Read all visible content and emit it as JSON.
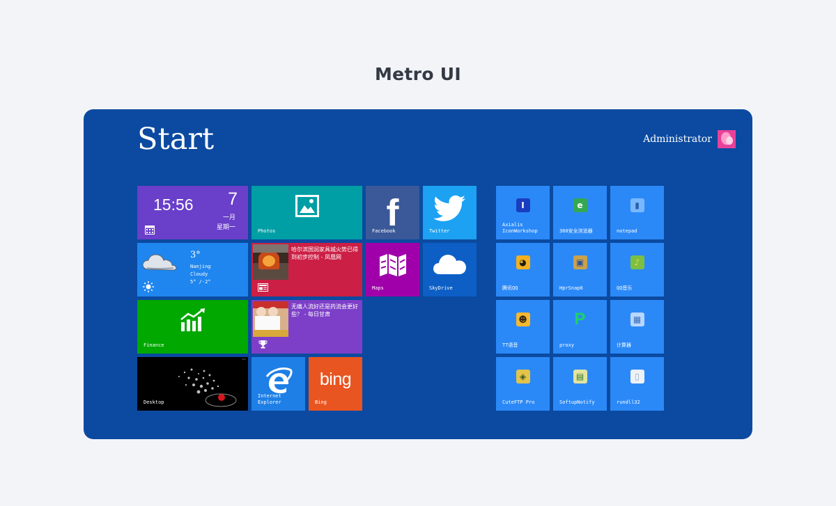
{
  "page_title": "Metro UI",
  "start": {
    "title": "Start",
    "user": "Administrator"
  },
  "clock": {
    "time": "15:56",
    "day": "7",
    "month": "一月",
    "weekday": "星期一"
  },
  "weather": {
    "temp": "3°",
    "city": "Nanjing",
    "condition": "Cloudy",
    "range": "5° /-2°"
  },
  "tiles": {
    "photos": "Photos",
    "facebook": "Facebook",
    "twitter": "Twitter",
    "maps": "Maps",
    "skydrive": "SkyDrive",
    "finance": "Finance",
    "desktop": "Desktop",
    "ie": "Internet Explorer",
    "bing": "Bing",
    "bing_logo": "bing",
    "facebook_logo": "f"
  },
  "news": {
    "headline": "哈尔滨国润家具城火势已得到初步控制 - 凤凰网"
  },
  "sports": {
    "headline": "无痛人流好还是药流会更好些？ - 每日甘肃"
  },
  "apps": [
    {
      "label": "Axialis IconWorkshop",
      "glyph": "I",
      "color": "#1a3dbf",
      "fg": "#ffffff"
    },
    {
      "label": "360安全浏览器",
      "glyph": "e",
      "color": "#34a853",
      "fg": "#ffffff"
    },
    {
      "label": "notepad",
      "glyph": "▮",
      "color": "#79b8ff",
      "fg": "#2a5fa8"
    },
    {
      "label": "腾讯QQ",
      "glyph": "◕",
      "color": "#f2b01e",
      "fg": "#1a1a1a"
    },
    {
      "label": "HprSnap6",
      "glyph": "▣",
      "color": "#c9a24a",
      "fg": "#2a4f9c"
    },
    {
      "label": "QQ音乐",
      "glyph": "♪",
      "color": "#7bc043",
      "fg": "#ffd43b"
    },
    {
      "label": "TT语音",
      "glyph": "☻",
      "color": "#f5b82e",
      "fg": "#3a2a10"
    },
    {
      "label": "proxy",
      "glyph": "P",
      "color": "transparent",
      "fg": "#1fd16a"
    },
    {
      "label": "计算器",
      "glyph": "▦",
      "color": "#b9d6ff",
      "fg": "#3a6fb8"
    },
    {
      "label": "CuteFTP Pro",
      "glyph": "◈",
      "color": "#e3c34a",
      "fg": "#3a5a20"
    },
    {
      "label": "SoftupNotify",
      "glyph": "▤",
      "color": "#e3e3a0",
      "fg": "#2b7a2b"
    },
    {
      "label": "rundll32",
      "glyph": "▯",
      "color": "#eef2f8",
      "fg": "#9aa9bd"
    }
  ],
  "colors": {
    "background": "#0b4aa0",
    "clock": "#6a3fc9",
    "photos": "#009fa5",
    "facebook": "#3b5998",
    "twitter": "#1da1f2",
    "weather": "#1f86ef",
    "news": "#cc1f45",
    "maps": "#a000aa",
    "skydrive": "#0d5fc6",
    "finance": "#00a800",
    "sports": "#7d3fc8",
    "desktop": "#000000",
    "ie": "#1e7fe6",
    "bing": "#e95520",
    "app_tile": "#2b89f7"
  }
}
